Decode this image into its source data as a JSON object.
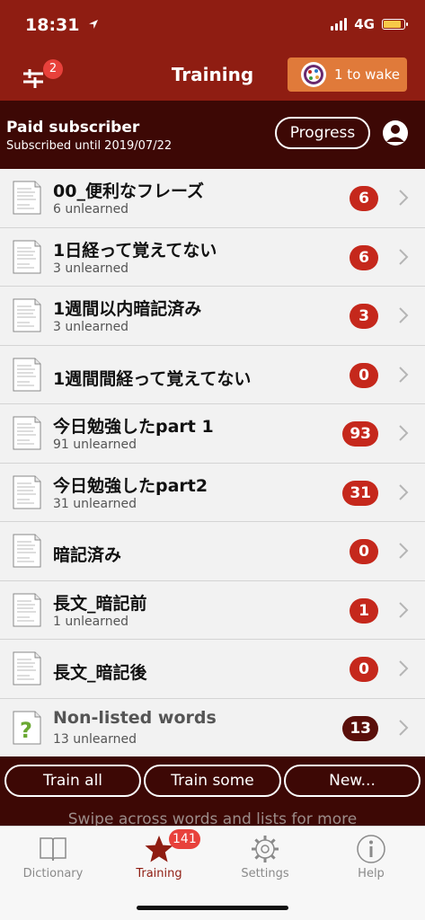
{
  "status": {
    "time": "18:31",
    "network": "4G"
  },
  "nav": {
    "title": "Training",
    "filter_badge": "2",
    "wake_label": "1 to wake"
  },
  "subscription": {
    "title": "Paid subscriber",
    "until": "Subscribed until 2019/07/22",
    "progress_label": "Progress"
  },
  "lists": [
    {
      "title": "00_便利なフレーズ",
      "subtitle": "6 unlearned",
      "count": "6"
    },
    {
      "title": "1日経って覚えてない",
      "subtitle": "3 unlearned",
      "count": "6"
    },
    {
      "title": "1週間以内暗記済み",
      "subtitle": "3 unlearned",
      "count": "3"
    },
    {
      "title": "1週間間経って覚えてない",
      "subtitle": "",
      "count": "0"
    },
    {
      "title": "今日勉強したpart 1",
      "subtitle": "91 unlearned",
      "count": "93"
    },
    {
      "title": "今日勉強したpart2",
      "subtitle": "31 unlearned",
      "count": "31"
    },
    {
      "title": "暗記済み",
      "subtitle": "",
      "count": "0"
    },
    {
      "title": "長文_暗記前",
      "subtitle": "1 unlearned",
      "count": "1"
    },
    {
      "title": "長文_暗記後",
      "subtitle": "",
      "count": "0"
    },
    {
      "title": "Non-listed words",
      "subtitle": "13 unlearned",
      "count": "13"
    }
  ],
  "actions": {
    "train_all": "Train all",
    "train_some": "Train some",
    "new": "New..."
  },
  "hint": "Swipe across words and lists for more",
  "tabs": [
    {
      "label": "Dictionary"
    },
    {
      "label": "Training",
      "badge": "141"
    },
    {
      "label": "Settings"
    },
    {
      "label": "Help"
    }
  ],
  "colors": {
    "brand": "#8f1d12",
    "dark": "#3d0805",
    "badge": "#c5281c",
    "accent": "#e07a3a"
  }
}
